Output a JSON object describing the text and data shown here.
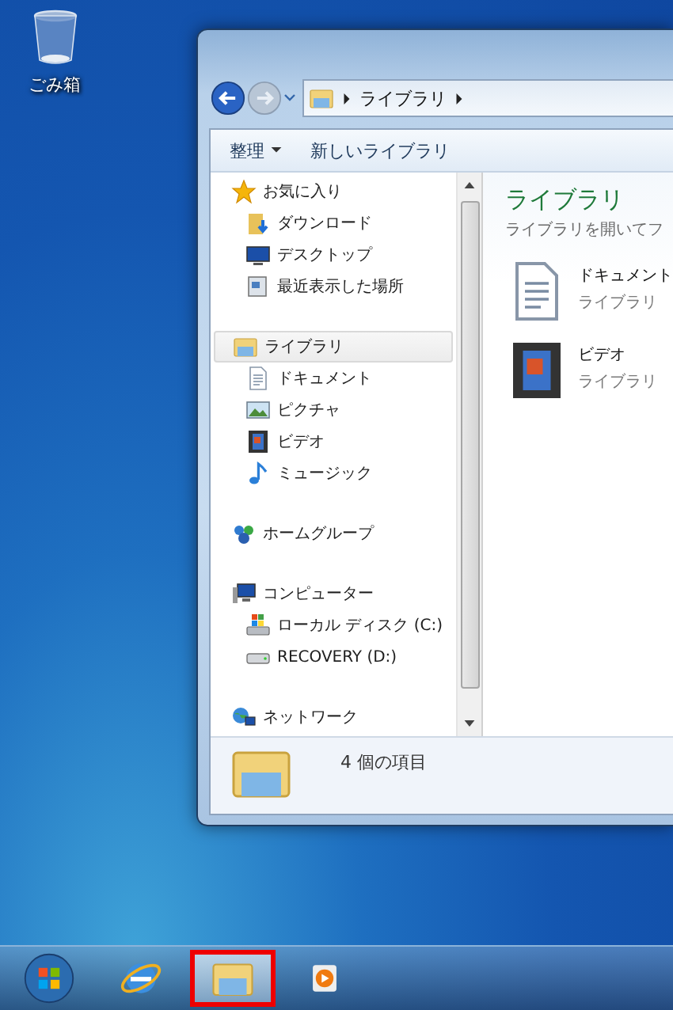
{
  "desktop_icons": [
    {
      "label": "ごみ箱",
      "kind": "trash"
    }
  ],
  "window": {
    "address": {
      "crumbs": [
        "ライブラリ"
      ]
    },
    "toolbar": [
      {
        "label": "整理",
        "dropdown": true
      },
      {
        "label": "新しいライブラリ",
        "dropdown": false
      }
    ],
    "nav_pane": [
      {
        "label": "お気に入り",
        "kind": "star",
        "selected": false,
        "children": [
          {
            "label": "ダウンロード",
            "kind": "download",
            "selected": false
          },
          {
            "label": "デスクトップ",
            "kind": "desktop",
            "selected": false
          },
          {
            "label": "最近表示した場所",
            "kind": "recent",
            "selected": false
          }
        ]
      },
      {
        "label": "ライブラリ",
        "kind": "library",
        "selected": true,
        "children": [
          {
            "label": "ドキュメント",
            "kind": "document",
            "selected": false
          },
          {
            "label": "ピクチャ",
            "kind": "picture",
            "selected": false
          },
          {
            "label": "ビデオ",
            "kind": "video",
            "selected": false
          },
          {
            "label": "ミュージック",
            "kind": "music",
            "selected": false
          }
        ]
      },
      {
        "label": "ホームグループ",
        "kind": "homegroup",
        "selected": false
      },
      {
        "label": "コンピューター",
        "kind": "computer",
        "selected": false,
        "children": [
          {
            "label": "ローカル ディスク (C:)",
            "kind": "sysdisk",
            "selected": false
          },
          {
            "label": "RECOVERY (D:)",
            "kind": "disk",
            "selected": false
          }
        ]
      },
      {
        "label": "ネットワーク",
        "kind": "network",
        "selected": false
      }
    ],
    "content": {
      "title": "ライブラリ",
      "subtitle": "ライブラリを開いてフ",
      "items": [
        {
          "name": "ドキュメント",
          "type": "ライブラリ",
          "kind": "document"
        },
        {
          "name": "ビデオ",
          "type": "ライブラリ",
          "kind": "video"
        }
      ]
    },
    "status_bar": {
      "text": "4 個の項目"
    }
  },
  "taskbar": [
    {
      "kind": "start",
      "highlighted": false
    },
    {
      "kind": "browser",
      "highlighted": false
    },
    {
      "kind": "explorer",
      "highlighted": true
    },
    {
      "kind": "media",
      "highlighted": false
    }
  ]
}
